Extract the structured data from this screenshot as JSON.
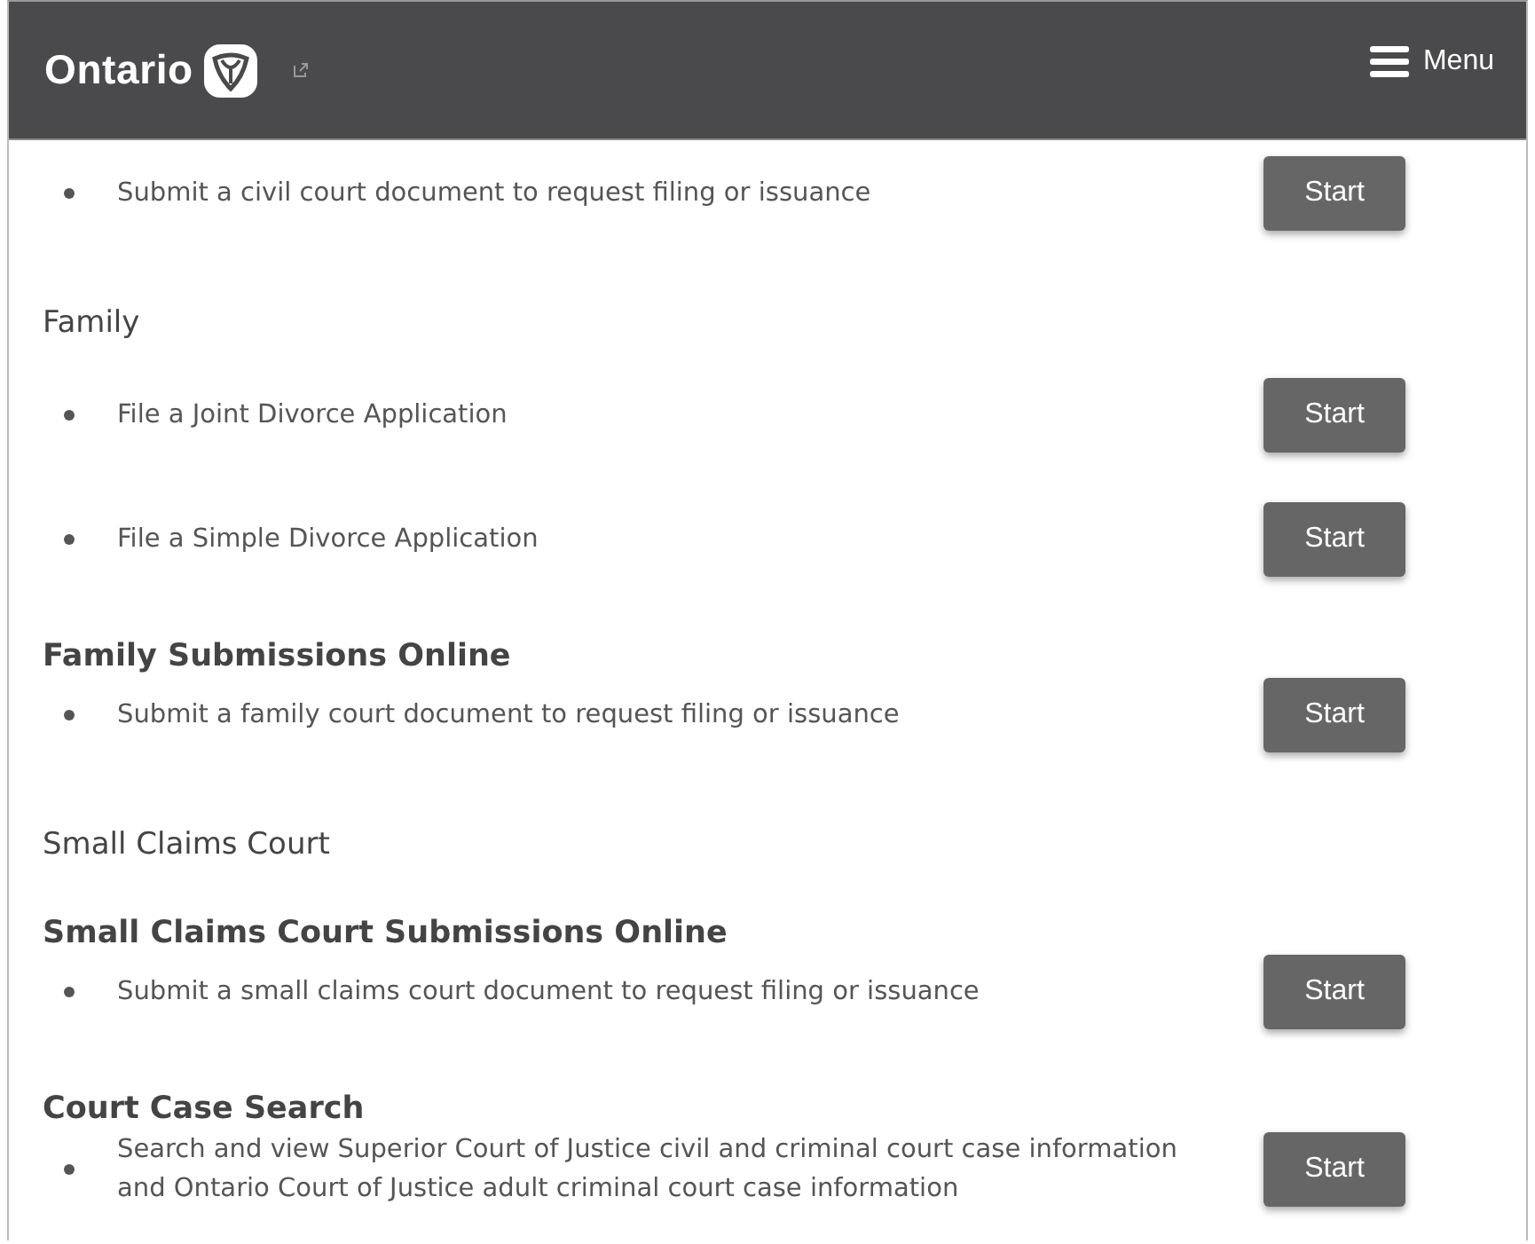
{
  "header": {
    "logo_text": "Ontario",
    "menu_label": "Menu"
  },
  "blocks": [
    {
      "kind": "item",
      "text": "Submit a civil court document to request filing or issuance",
      "button": "Start"
    },
    {
      "kind": "section",
      "text": "Family"
    },
    {
      "kind": "item",
      "text": "File a Joint Divorce Application",
      "button": "Start"
    },
    {
      "kind": "item",
      "text": "File a Simple Divorce Application",
      "button": "Start"
    },
    {
      "kind": "service",
      "text": "Family Submissions Online"
    },
    {
      "kind": "item",
      "text": "Submit a family court document to request filing or issuance",
      "button": "Start"
    },
    {
      "kind": "section",
      "text": "Small Claims Court"
    },
    {
      "kind": "service",
      "text": "Small Claims Court Submissions Online"
    },
    {
      "kind": "item",
      "text": "Submit a small claims court document to request filing or issuance",
      "button": "Start"
    },
    {
      "kind": "service",
      "text": "Court Case Search"
    },
    {
      "kind": "item",
      "text": "Search and view Superior Court of Justice civil and criminal court case information and Ontario Court of Justice adult criminal court case information",
      "button": "Start"
    }
  ]
}
